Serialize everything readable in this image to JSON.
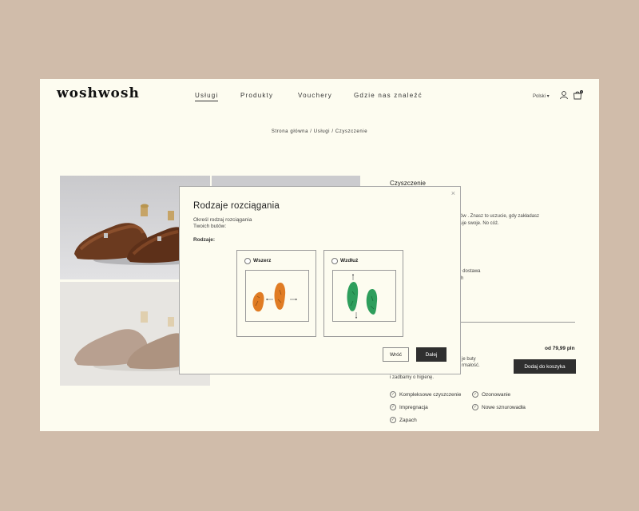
{
  "brand": {
    "logo": "woshwosh"
  },
  "nav": {
    "items": [
      {
        "label": "Usługi",
        "active": true
      },
      {
        "label": "Produkty"
      },
      {
        "label": "Vouchery"
      },
      {
        "label": "Gdzie nas znaleźć"
      }
    ],
    "language": "Polski ▾"
  },
  "cart": {
    "count": "0"
  },
  "breadcrumb": "Strona główna / Usługi / Czyszczenie",
  "product": {
    "title": "Czyszczenie",
    "desc_line1": "ów . Znasz to uczucie, gdy zakładasz",
    "desc_line2": "uje swoje. No cóż.",
    "ship_line1": "+ dostawa",
    "ship_line2": "ch",
    "price": "od 79,99 pln",
    "partial_line1": "je buty",
    "partial_line2": "rmałość.",
    "hygiene": "i zadbamy o higienę.",
    "add_to_cart": "Dodaj do koszyka",
    "features": [
      "Kompleksowe czyszczenie",
      "Ozonowanie",
      "Impregnacja",
      "Nowe sznurowadła",
      "Zapach"
    ]
  },
  "modal": {
    "title": "Rodzaje rozciągania",
    "subtitle_line1": "Określ rodzaj rozciągania",
    "subtitle_line2": "Twoich butów:",
    "kinds_label": "Rodzaje:",
    "options": [
      {
        "label": "Wszerz",
        "color": "#e07c24"
      },
      {
        "label": "Wzdłuż",
        "color": "#2e9e5c"
      }
    ],
    "back_button": "Wróć",
    "next_button": "Dalej"
  }
}
